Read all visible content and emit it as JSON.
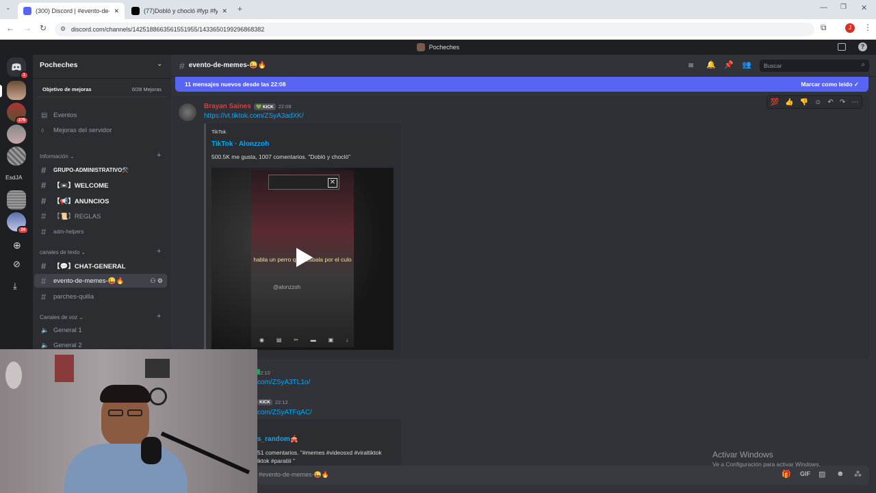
{
  "browser": {
    "tabs": [
      {
        "label": "(300) Discord | #evento-de-me",
        "close": "✕"
      },
      {
        "label": "(77)Dobló y chocló #fyp #fyp",
        "close": "✕"
      }
    ],
    "new_tab": "+",
    "url": "discord.com/channels/1425188663561551955/1433650199296868382",
    "profile_initial": "J"
  },
  "discord": {
    "window_title": "Pocheches",
    "guild_badges": {
      "home": "1",
      "g2": "275",
      "g7": "24"
    },
    "server_text_icon": "EsdJA",
    "server_name": "Pocheches",
    "boost_goal": {
      "label": "Objetivo de mejoras",
      "progress": "0/28 Mejoras"
    },
    "sidebar_links": [
      "Eventos",
      "Mejoras del servidor"
    ],
    "categories": {
      "info": "Información",
      "text": "canales de texto",
      "voice": "Canales de voz"
    },
    "info_channels": [
      "GRUPO-ADMINISTRATIVO⚒️",
      "【📼】WELCOME",
      "【📢】ANUNCIOS",
      "【📜】REGLAS",
      "adm-helpers"
    ],
    "text_channels": [
      "【💬】CHAT-GENERAL",
      "evento-de-memes-😜🔥",
      "parches-quilla"
    ],
    "voice_channels": [
      "General 1",
      "General 2"
    ],
    "channel_title": "evento-de-memes-😜🔥",
    "search_placeholder": "Buscar",
    "new_messages": {
      "label": "11 mensajes nuevos desde las 22:08",
      "action": "Marcar como leído"
    },
    "messages": [
      {
        "author": "Brayan Saines",
        "tag": "💚 KICK",
        "time": "22:08",
        "link": "https://vt.tiktok.com/ZSyA3adXK/",
        "embed": {
          "provider": "TikTok",
          "title": "TikTok · Alonzzoh",
          "description": "500.5K me gusta, 1007 comentarios. \"Dobló y chocló\"",
          "video_caption": "habla un perro que resbala por el culo",
          "video_watermark": "@alonzzoh"
        }
      },
      {
        "time": "22:10",
        "link": "com/ZSyA3TL1o/"
      },
      {
        "tag": "KICK",
        "time": "22:12",
        "link": "com/ZSyATFqAC/",
        "embed_title": "s_random🎪",
        "embed_description": "51 comentarios. \"#memes #videosxd #viraltiktok",
        "embed_description2": "iktok #paratiii \""
      }
    ],
    "message_reactions": [
      "💯",
      "👍",
      "👎"
    ],
    "input_placeholder": "#evento-de-memes-😜🔥"
  },
  "watermark": {
    "title": "Activar Windows",
    "subtitle": "Ve a Configuración para activar Windows."
  }
}
